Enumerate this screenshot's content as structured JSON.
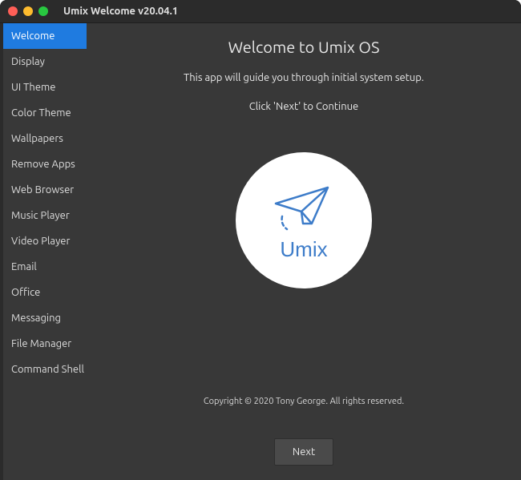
{
  "window": {
    "title": "Umix Welcome v20.04.1"
  },
  "sidebar": {
    "items": [
      {
        "label": "Welcome",
        "active": true
      },
      {
        "label": "Display"
      },
      {
        "label": "UI Theme"
      },
      {
        "label": "Color Theme"
      },
      {
        "label": "Wallpapers"
      },
      {
        "label": "Remove Apps"
      },
      {
        "label": "Web Browser"
      },
      {
        "label": "Music Player"
      },
      {
        "label": "Video Player"
      },
      {
        "label": "Email"
      },
      {
        "label": "Office"
      },
      {
        "label": "Messaging"
      },
      {
        "label": "File Manager"
      },
      {
        "label": "Command Shell"
      }
    ]
  },
  "main": {
    "heading": "Welcome to Umix OS",
    "subtext": "This app will guide you through initial system setup.",
    "click_next": "Click 'Next' to Continue",
    "logo_text": "Umix",
    "copyright": "Copyright © 2020 Tony George. All rights reserved.",
    "next_label": "Next"
  },
  "colors": {
    "accent": "#1f7be0",
    "bg": "#383838",
    "logo": "#3d7cc9"
  }
}
